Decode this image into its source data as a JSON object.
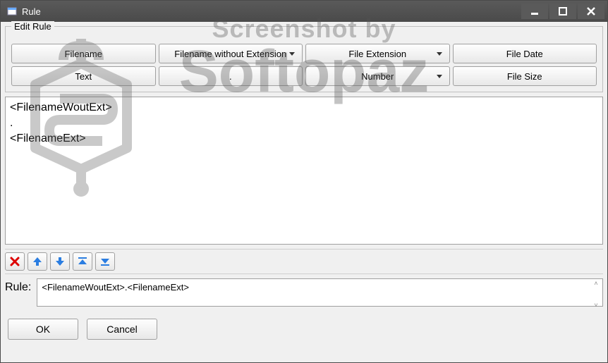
{
  "window": {
    "title": "Rule"
  },
  "groupbox": {
    "label": "Edit Rule"
  },
  "grid": {
    "r1c1": "Filename",
    "r1c2": "Filename without Extension",
    "r1c3": "File Extension",
    "r1c4": "File Date",
    "r2c1": "Text",
    "r2c2": ".",
    "r2c3": "Number",
    "r2c4": "File Size"
  },
  "list": {
    "item1": "<FilenameWoutExt>",
    "item2": ".",
    "item3": "<FilenameExt>"
  },
  "rule": {
    "label": "Rule:",
    "value": "<FilenameWoutExt>.<FilenameExt>"
  },
  "actions": {
    "ok": "OK",
    "cancel": "Cancel"
  },
  "watermark": {
    "line1": "Screenshot by",
    "line2": "Softopaz"
  }
}
